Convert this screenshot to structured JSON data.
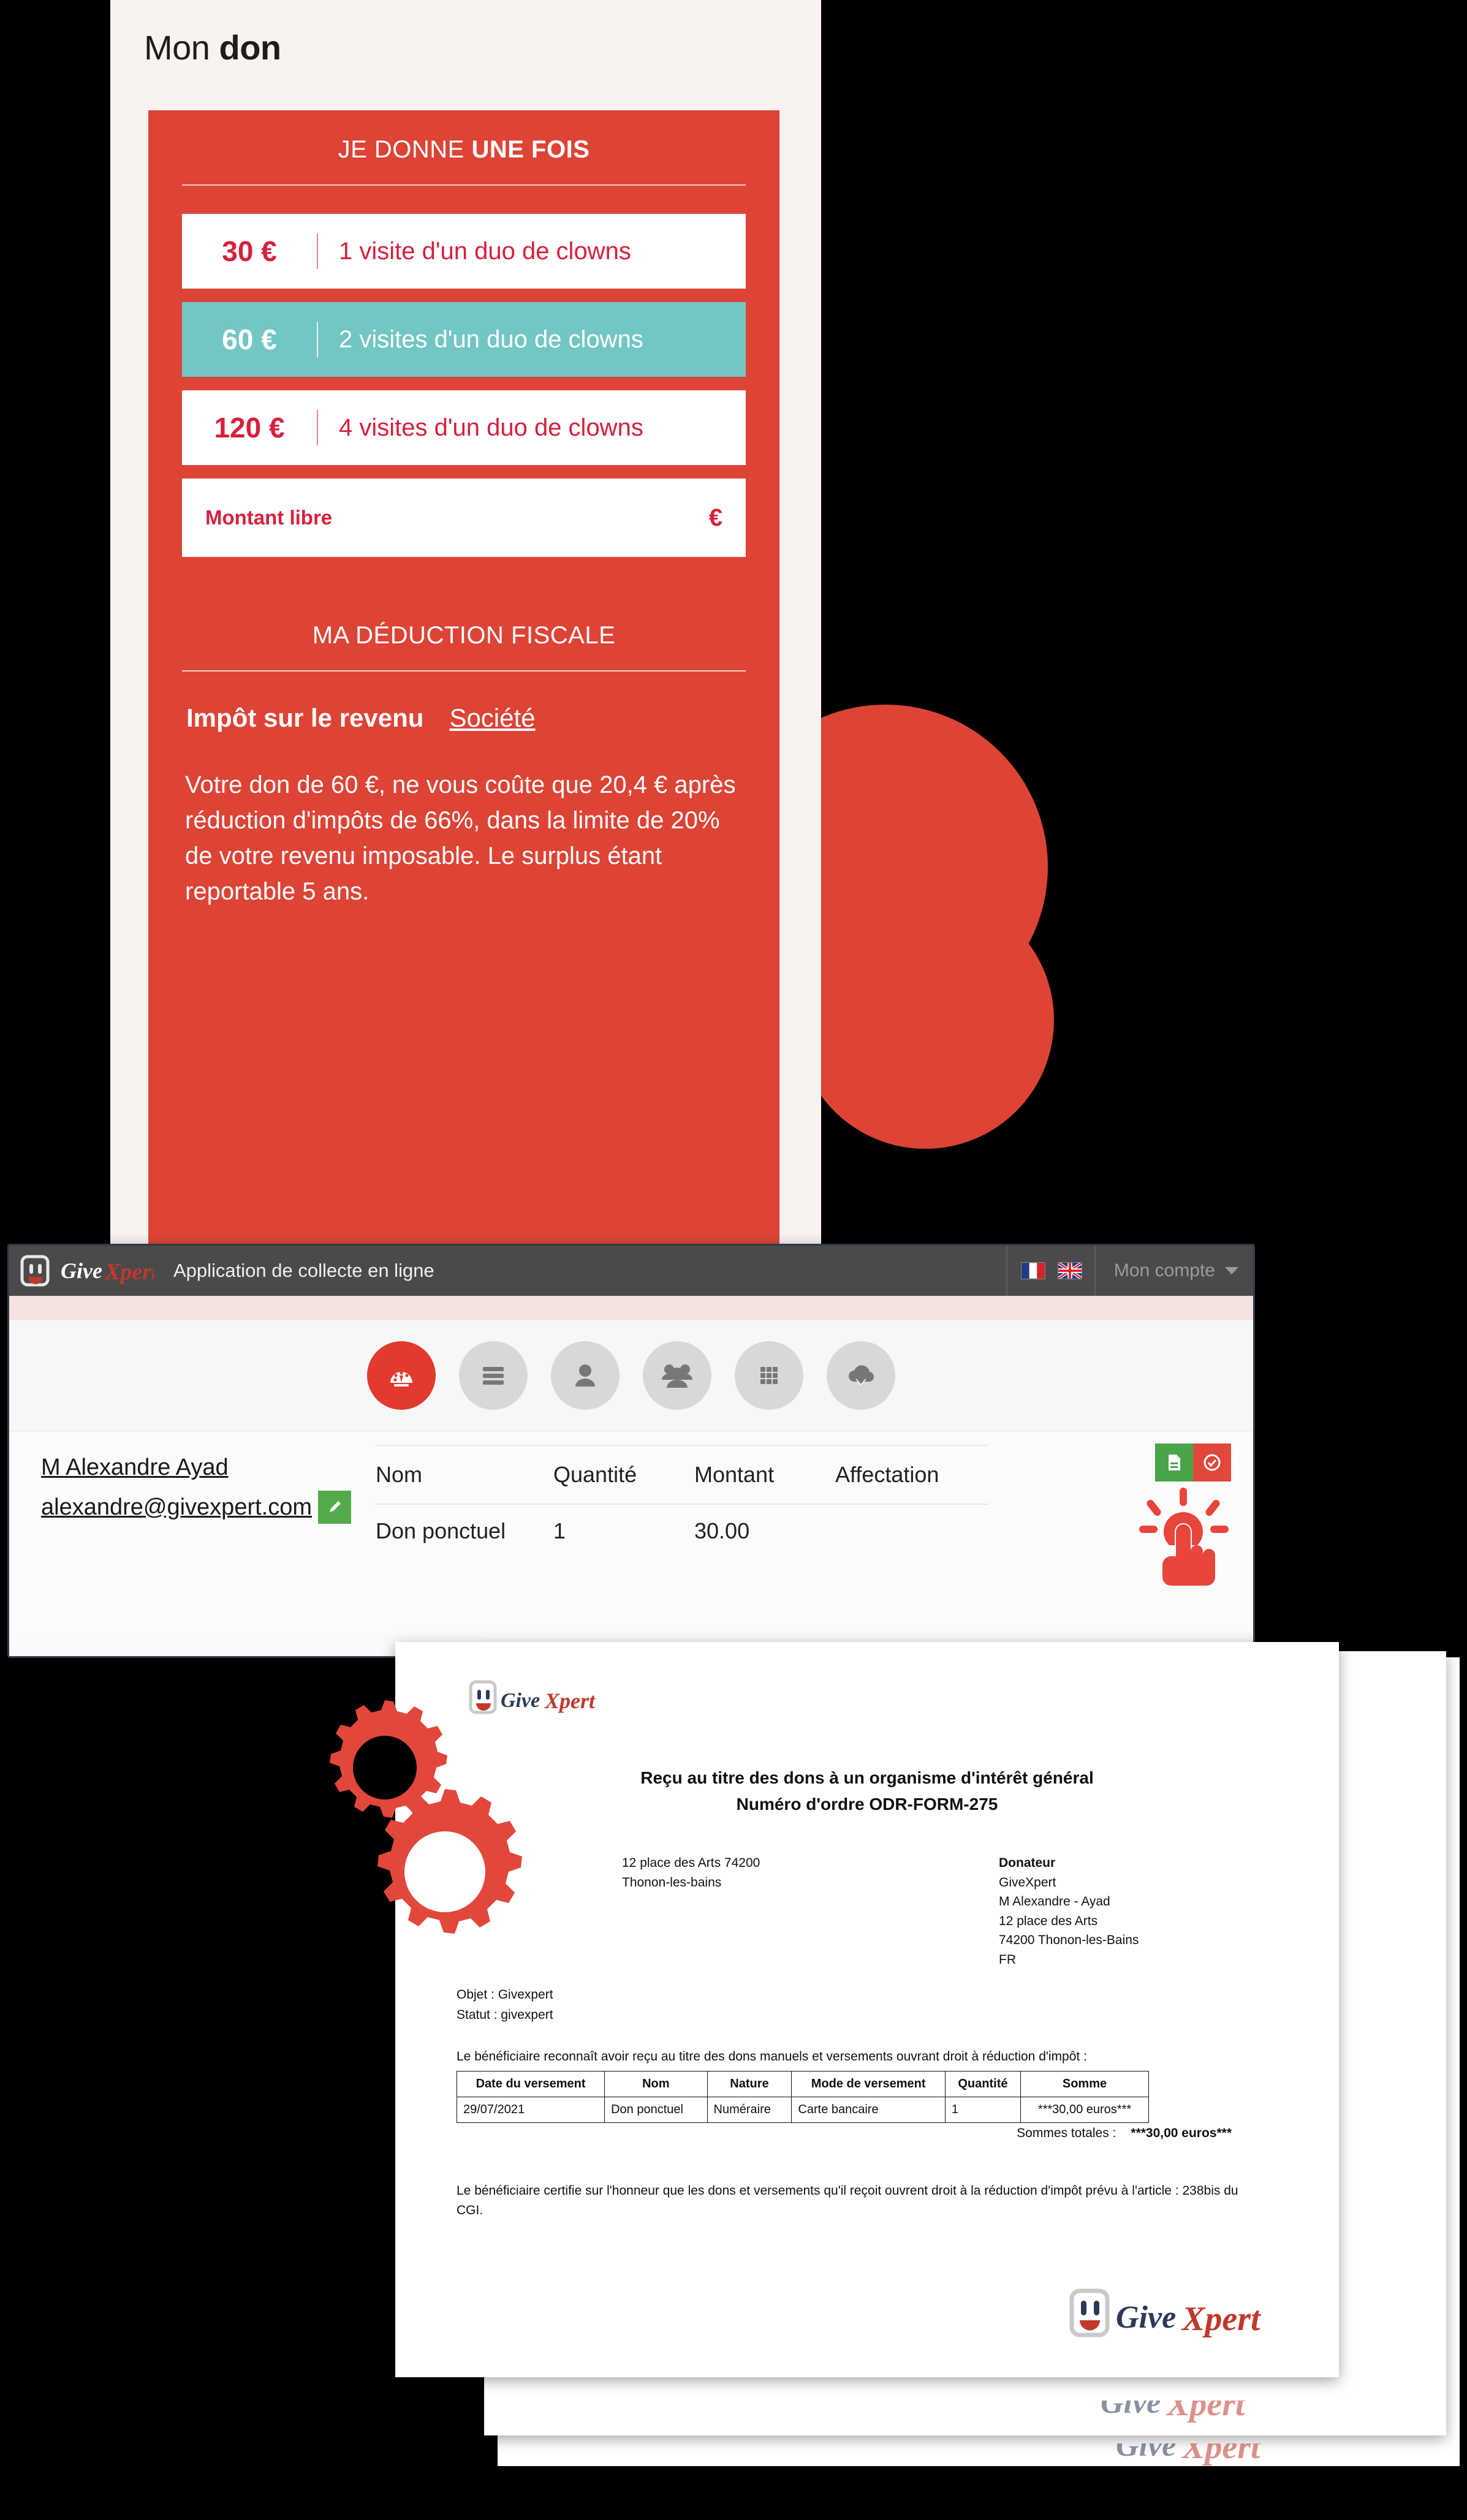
{
  "donation_form": {
    "title_regular": "Mon ",
    "title_bold": "don",
    "once_heading_regular": "JE DONNE ",
    "once_heading_bold": "UNE FOIS",
    "options": [
      {
        "amount": "30 €",
        "description": "1 visite d'un duo de clowns",
        "selected": false
      },
      {
        "amount": "60 €",
        "description": "2 visites d'un duo de clowns",
        "selected": true
      },
      {
        "amount": "120 €",
        "description": "4 visites d'un duo de clowns",
        "selected": false
      }
    ],
    "free_amount_label": "Montant libre",
    "free_amount_currency": "€",
    "fiscal_heading": "MA DÉDUCTION FISCALE",
    "tab_income_tax": "Impôt sur le revenu",
    "tab_company": "Société",
    "fiscal_text": "Votre don de 60 €, ne vous coûte que 20,4 € après réduction d'impôts de 66%, dans la limite de 20% de votre revenu imposable. Le surplus étant reportable 5 ans.",
    "selected_color": "#72c6c4",
    "accent_color": "#dd4436",
    "amount_color": "#d81f3c"
  },
  "app_window": {
    "logo_text": "GiveXpert",
    "title": "Application de collecte en ligne",
    "account_label": "Mon compte",
    "flags": [
      "flag-fr-icon",
      "flag-uk-icon"
    ],
    "nav_items": [
      {
        "name": "dashboard",
        "icon": "gauge-icon",
        "active": true
      },
      {
        "name": "lists",
        "icon": "list-icon",
        "active": false
      },
      {
        "name": "contact",
        "icon": "person-icon",
        "active": false
      },
      {
        "name": "groups",
        "icon": "people-icon",
        "active": false
      },
      {
        "name": "grid",
        "icon": "grid-icon",
        "active": false
      },
      {
        "name": "download",
        "icon": "cloud-download-icon",
        "active": false
      }
    ],
    "donor_name": "M Alexandre Ayad",
    "donor_email": "alexandre@givexpert.com",
    "edit_icon": "pencil-icon",
    "table": {
      "headers": [
        "Nom",
        "Quantité",
        "Montant",
        "Affectation"
      ],
      "rows": [
        {
          "nom": "Don ponctuel",
          "quantite": "1",
          "montant": "30.00",
          "affectation": ""
        }
      ]
    },
    "action_buttons": [
      {
        "name": "generate-receipt",
        "icon": "document-icon",
        "color": "#4aa44a"
      },
      {
        "name": "validate-receipt",
        "icon": "check-circle-icon",
        "color": "#e2473c"
      }
    ]
  },
  "receipt": {
    "logo_text": "GiveXpert",
    "title_line1": "Reçu au titre des dons à un organisme d'intérêt général",
    "title_line2": "Numéro d'ordre ODR-FORM-275",
    "address_left_line1": "12 place des Arts 74200",
    "address_left_line2": "Thonon-les-bains",
    "donor_heading": "Donateur",
    "donor_org": "GiveXpert",
    "donor_name": "M Alexandre - Ayad",
    "donor_street": "12 place des Arts",
    "donor_city": "74200 Thonon-les-Bains",
    "donor_country": "FR",
    "objet": "Objet : Givexpert",
    "statut": "Statut : givexpert",
    "intro": "Le bénéficiaire reconnaît avoir reçu au titre des dons manuels et versements ouvrant droit à réduction d'impôt :",
    "table": {
      "headers": [
        "Date du versement",
        "Nom",
        "Nature",
        "Mode de versement",
        "Quantité",
        "Somme"
      ],
      "rows": [
        {
          "date": "29/07/2021",
          "nom": "Don ponctuel",
          "nature": "Numéraire",
          "mode": "Carte bancaire",
          "quantite": "1",
          "somme": "***30,00 euros***"
        }
      ]
    },
    "totals_label": "Sommes totales :",
    "totals_value": "***30,00 euros***",
    "certification": "Le bénéficiaire certifie sur l'honneur que les dons et versements qu'il reçoit ouvrent droit à la réduction d'impôt prévu à l'article : 238bis du CGI."
  }
}
